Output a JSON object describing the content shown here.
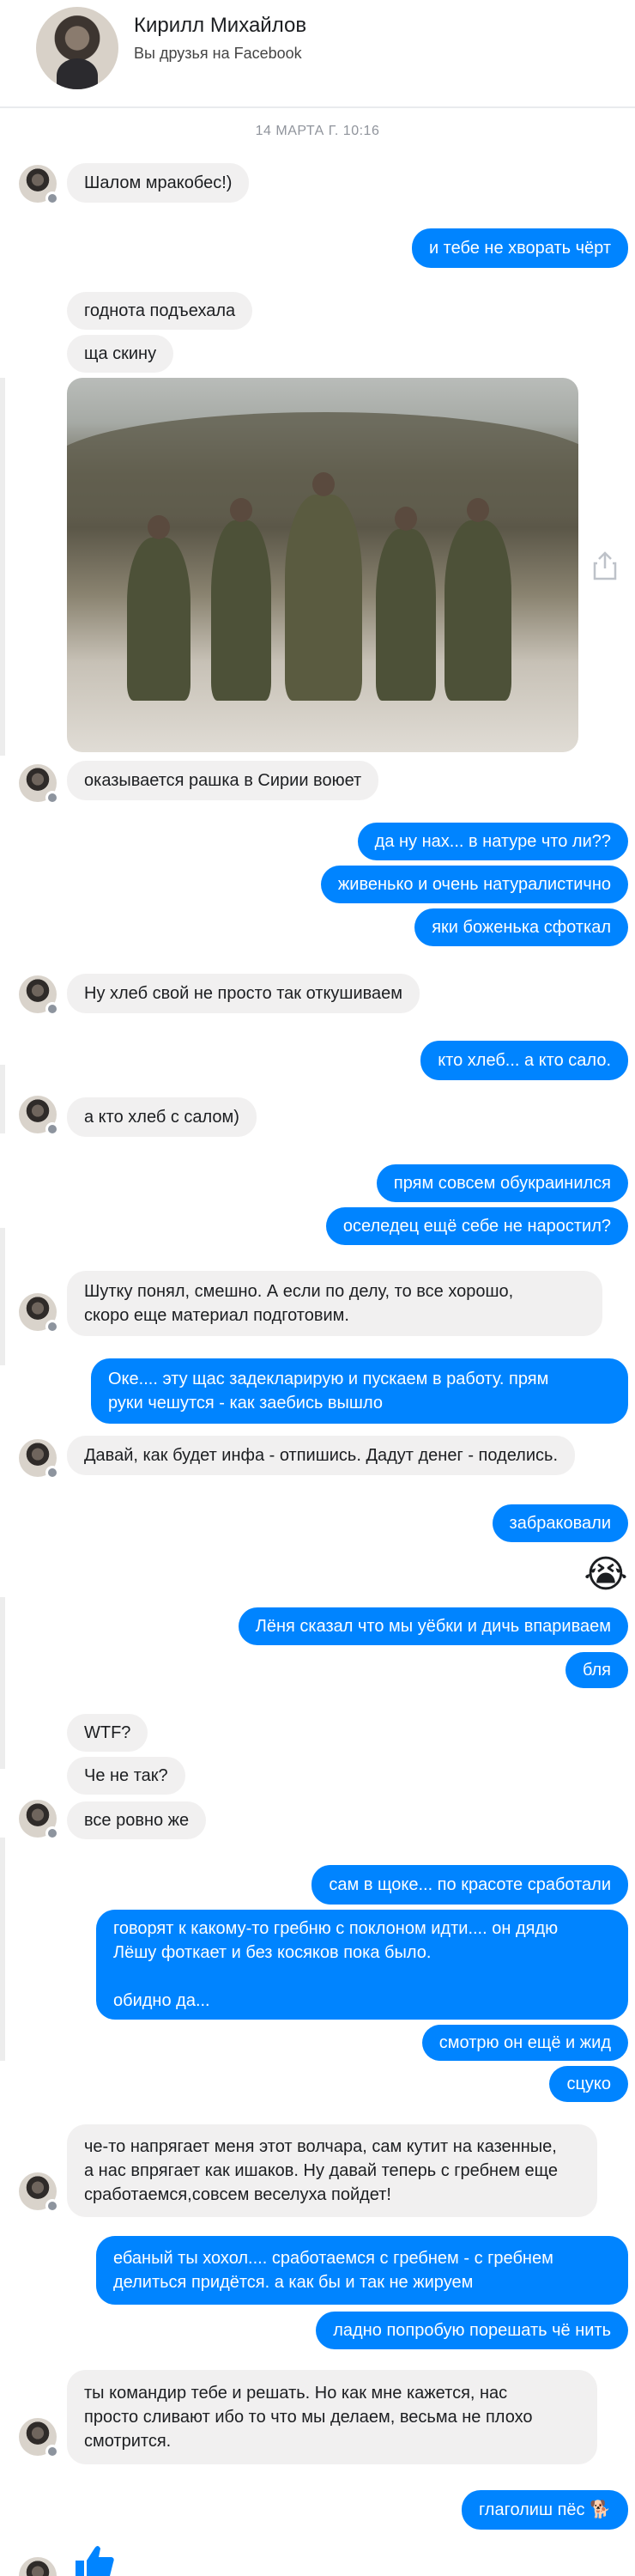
{
  "header": {
    "name": "Кирилл Михайлов",
    "subtitle": "Вы друзья на Facebook"
  },
  "timestamp": "14 МАРТА Г. 10:16",
  "messages": [
    {
      "side": "in",
      "text": "Шалом мракобес!)"
    },
    {
      "side": "out",
      "text": "и тебе не хворать чёрт"
    },
    {
      "side": "in",
      "text": "годнота подъехала"
    },
    {
      "side": "in",
      "text": "ща скину"
    },
    {
      "side": "in",
      "text": "оказывается рашка в Сирии воюет"
    },
    {
      "side": "out",
      "text": "да ну нах... в натуре что ли??"
    },
    {
      "side": "out",
      "text": "живенько и очень натуралистично"
    },
    {
      "side": "out",
      "text": "яки боженька сфоткал"
    },
    {
      "side": "in",
      "text": "Ну хлеб свой не просто так откушиваем"
    },
    {
      "side": "out",
      "text": "кто хлеб... а кто сало."
    },
    {
      "side": "in",
      "text": "а кто хлеб с салом)"
    },
    {
      "side": "out",
      "text": "прям совсем обукраинился"
    },
    {
      "side": "out",
      "text": "оселедец ещё себе не наростил?"
    },
    {
      "side": "in",
      "lines": [
        "Шутку понял, смешно. А если по делу, то все хорошо,",
        "скоро еще материал подготовим."
      ]
    },
    {
      "side": "out",
      "lines": [
        "Оке.... эту щас задекларирую и пускаем в работу. прям",
        "руки чешутся - как заебись вышло"
      ]
    },
    {
      "side": "in",
      "text": "Давай, как будет инфа - отпишись. Дадут денег - поделись."
    },
    {
      "side": "out",
      "text": "забраковали"
    },
    {
      "side": "out",
      "text": "Лёня сказал что мы уёбки и дичь впариваем"
    },
    {
      "side": "out",
      "text": "бля"
    },
    {
      "side": "in",
      "text": "WTF?"
    },
    {
      "side": "in",
      "text": "Че не так?"
    },
    {
      "side": "in",
      "text": "все ровно же"
    },
    {
      "side": "out",
      "text": "сам в щоке... по красоте сработали"
    },
    {
      "side": "out",
      "lines": [
        "говорят к какому-то гребню с поклоном идти.... он дядю",
        "Лёшу фоткает и без косяков пока было.",
        "",
        "обидно да..."
      ]
    },
    {
      "side": "out",
      "text": "смотрю он ещё и жид"
    },
    {
      "side": "out",
      "text": "сцуко"
    },
    {
      "side": "in",
      "lines": [
        "че-то напрягает меня этот волчара, сам кутит на казенные,",
        "а нас впрягает как ишаков. Ну давай теперь с гребнем еще",
        "сработаемся,совсем веселуха пойдет!"
      ]
    },
    {
      "side": "out",
      "lines": [
        "ебаный ты хохол.... сработаемся с гребнем - с гребнем",
        "делиться придётся. а как бы и так не жируем"
      ]
    },
    {
      "side": "out",
      "text": "ладно попробую порешать чё нить"
    },
    {
      "side": "in",
      "lines": [
        "ты командир тебе и решать. Но как мне кажется, нас",
        "просто сливают ибо то что мы делаем, весьма не плохо",
        "смотрится."
      ]
    },
    {
      "side": "out",
      "text": "глаголиш пёс 🐕"
    }
  ],
  "emoji": "😭",
  "icons": {
    "share": "share-icon",
    "like": "thumbs-up-icon",
    "badge": "messenger-badge-icon"
  },
  "colors": {
    "outgoing_bubble": "#0084ff",
    "incoming_bubble": "#f1f0f0",
    "timestamp": "#90949c"
  }
}
